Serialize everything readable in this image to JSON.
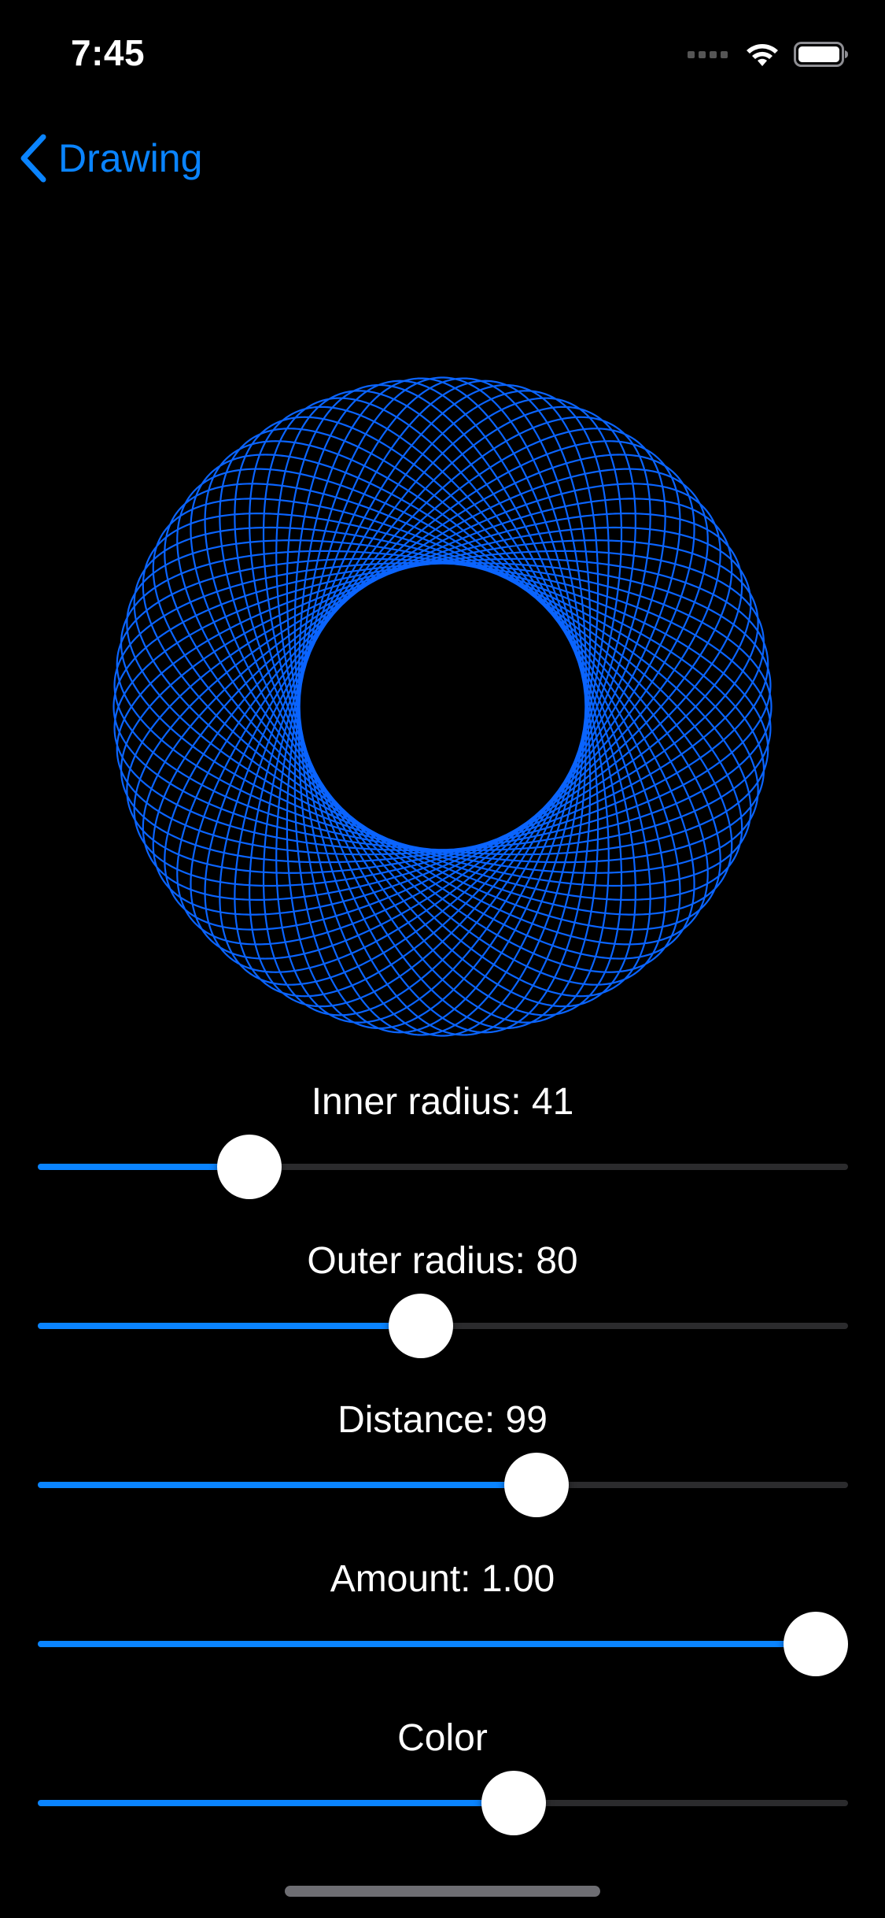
{
  "status_bar": {
    "time": "7:45"
  },
  "nav": {
    "back_label": "Drawing"
  },
  "colors": {
    "accent": "#0a84ff",
    "stroke": "#0a64ff",
    "background": "#000000"
  },
  "spirograph": {
    "inner_radius": 41,
    "outer_radius": 80,
    "distance": 99,
    "amount": 1.0
  },
  "controls": [
    {
      "label": "Inner radius: 41",
      "value": 0.24
    },
    {
      "label": "Outer radius: 80",
      "value": 0.47
    },
    {
      "label": "Distance: 99",
      "value": 0.625
    },
    {
      "label": "Amount: 1.00",
      "value": 1.0
    },
    {
      "label": "Color",
      "value": 0.595
    }
  ]
}
